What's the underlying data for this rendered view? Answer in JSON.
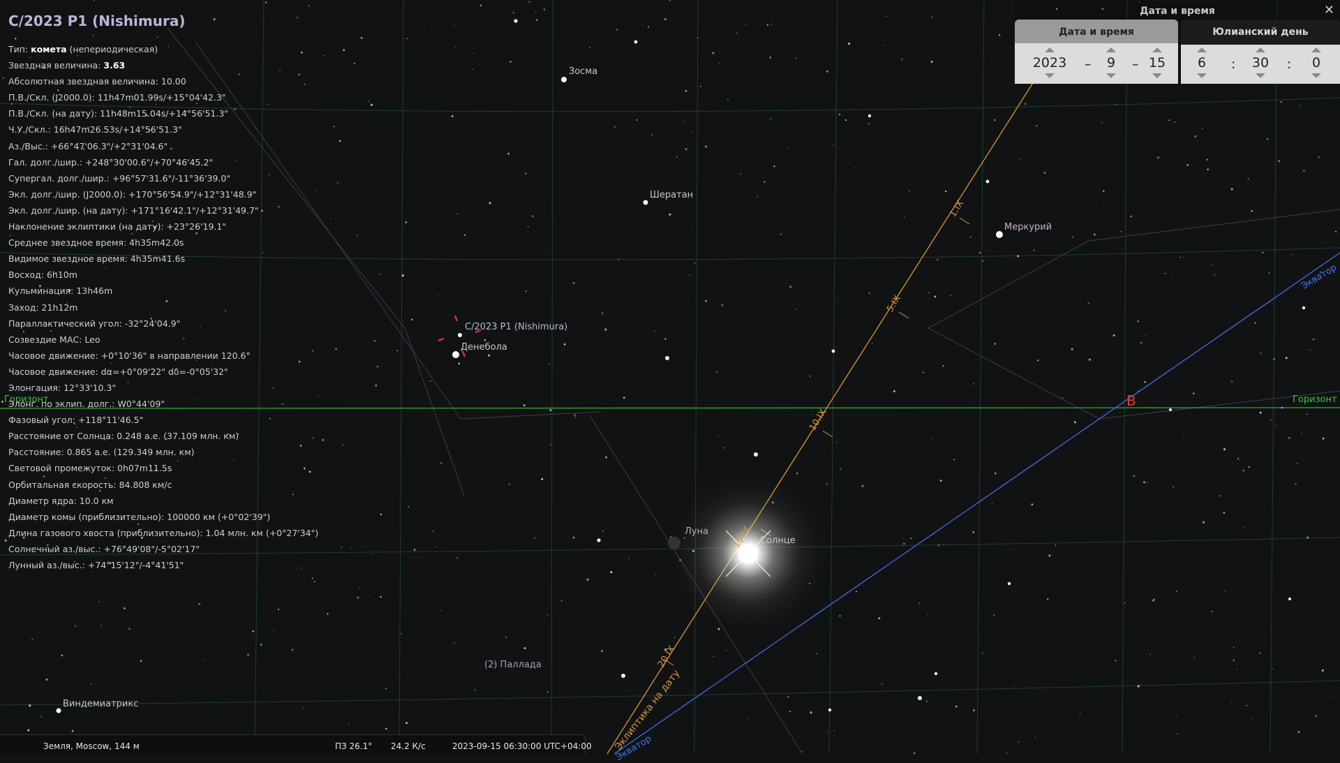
{
  "info": {
    "title": "C/2023 P1 (Nishimura)",
    "type_prefix": "Тип: ",
    "type_value": "комета",
    "type_suffix": " (непериодическая)",
    "mag_prefix": "Звездная величина: ",
    "mag_value": "3.63",
    "lines": [
      "Абсолютная звездная величина: 10.00",
      "П.В./Скл. (J2000.0): 11h47m01.99s/+15°04'42.3\"",
      "П.В./Скл. (на дату): 11h48m15.04s/+14°56'51.3\"",
      "Ч.У./Скл.: 16h47m26.53s/+14°56'51.3\"",
      "Аз./Выс.: +66°47'06.3\"/+2°31'04.6\"",
      "Гал. долг./шир.: +248°30'00.6\"/+70°46'45.2\"",
      "Супергал. долг./шир.: +96°57'31.6\"/-11°36'39.0\"",
      "Экл. долг./шир. (J2000.0): +170°56'54.9\"/+12°31'48.9\"",
      "Экл. долг./шир. (на дату): +171°16'42.1\"/+12°31'49.7\"",
      "Наклонение эклиптики (на дату): +23°26'19.1\"",
      "Среднее звездное время: 4h35m42.0s",
      "Видимое звездное время: 4h35m41.6s",
      "Восход: 6h10m",
      "Кульминация: 13h46m",
      "Заход: 21h12m",
      "Параллактический угол: -32°24'04.9\"",
      "Созвездие МАС: Leo",
      "Часовое движение: +0°10'36\" в направлении 120.6°",
      "Часовое движение: dα=+0°09'22\" dδ=-0°05'32\"",
      "Элонгация: 12°33'10.3\"",
      "Элонг. по эклип. долг.: W0°44'09\"",
      "Фазовый угол: +118°11'46.5\"",
      "Расстояние от Солнца: 0.248 а.е. (37.109 млн. км)",
      "Расстояние: 0.865 а.е. (129.349 млн. км)",
      "Световой промежуток: 0h07m11.5s",
      "Орбитальная скорость: 84.808 км/с",
      "Диаметр ядра: 10.0 км",
      "Диаметр комы (приблизительно): 100000 км (+0°02'39\")",
      "Длина газового хвоста (приблизительно): 1.04 млн. км (+0°27'34\")",
      "Солнечный аз./выс.: +76°49'08\"/-5°02'17\"",
      "Лунный аз./выс.: +74°15'12\"/-4°41'51\""
    ]
  },
  "sky_labels": {
    "zosma": "Зосма",
    "sheratan": "Шератан",
    "mercury": "Меркурий",
    "comet": "C/2023 P1 (Nishimura)",
    "denebola": "Денебола",
    "moon": "Луна",
    "sun": "Солнце",
    "pallas": "(2) Паллада",
    "vindemiatrix": "Виндемиатрикс",
    "horizon_left": "Горизонт",
    "horizon_right": "Горизонт",
    "equator_right": "Экватор",
    "equator_bottom": "Экватор",
    "ecliptic": "Эклиптика на дату",
    "cardinal_east": "В",
    "date_ticks": [
      "1.IX",
      "5.IX",
      "10.IX",
      "15.IX",
      "20.IX"
    ]
  },
  "datetime_panel": {
    "title": "Дата и время",
    "close_glyph": "✕",
    "tab_date": "Дата и время",
    "tab_jd": "Юлианский день",
    "year": "2023",
    "month": "9",
    "day": "15",
    "hour": "6",
    "minute": "30",
    "second": "0",
    "date_sep": "–",
    "time_sep": ":"
  },
  "statusbar": {
    "location": "Земля, Moscow, 144 м",
    "fov": "ПЗ 26.1°",
    "fps": "24.2 К/с",
    "datetime": "2023-09-15 06:30:00 UTC+04:00"
  },
  "colors": {
    "horizon": "#33cc33",
    "equator": "#4477ee",
    "ecliptic": "#d89a3c",
    "grid": "#1e4a3a",
    "cardinal": "#e04030"
  }
}
